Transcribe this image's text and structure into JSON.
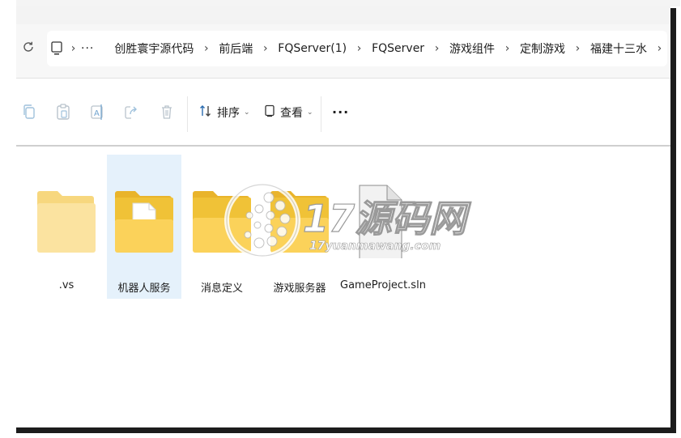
{
  "address_bar": {
    "refresh_icon": "refresh-icon",
    "location_icon": "this-pc-icon",
    "overflow": "···",
    "breadcrumbs": [
      "创胜寰宇源代码",
      "前后端",
      "FQServer(1)",
      "FQServer",
      "游戏组件",
      "定制游戏",
      "福建十三水"
    ]
  },
  "toolbar": {
    "copy_icon": "copy-icon",
    "paste_icon": "paste-icon",
    "rename_icon": "rename-icon",
    "share_icon": "share-icon",
    "delete_icon": "trash-icon",
    "sort_label": "排序",
    "view_label": "查看",
    "more_label": "···"
  },
  "files": [
    {
      "name": ".vs",
      "type": "folder"
    },
    {
      "name": "机器人服务",
      "type": "folder-with-document",
      "selected": true
    },
    {
      "name": "消息定义",
      "type": "folder"
    },
    {
      "name": "游戏服务器",
      "type": "folder"
    },
    {
      "name": "GameProject.sln",
      "type": "file"
    }
  ],
  "watermark": {
    "main": "17源码网",
    "url": "17yuanmawang.com"
  },
  "colors": {
    "folder_back": "#f0c237",
    "folder_front": "#fbd25a",
    "folder_light": "#fbe3a0",
    "selected_bg": "#e5f1fb"
  }
}
